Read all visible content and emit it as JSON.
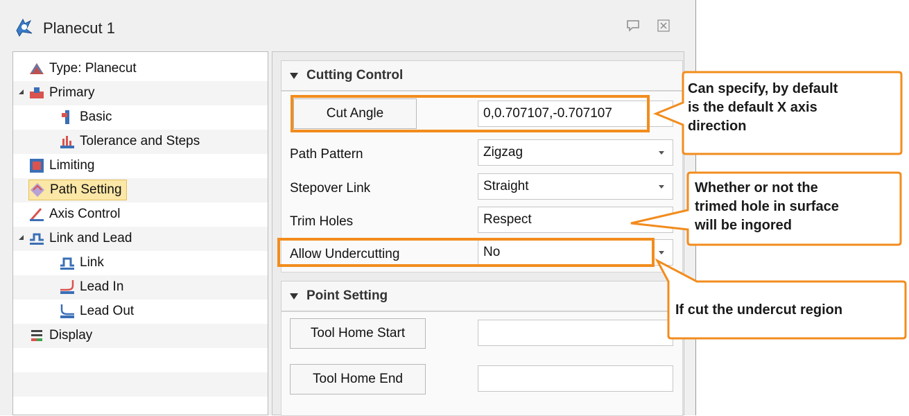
{
  "window": {
    "title": "Planecut 1"
  },
  "tree": {
    "items": [
      {
        "label": "Type: Planecut"
      },
      {
        "label": "Primary"
      },
      {
        "label": "Basic"
      },
      {
        "label": "Tolerance and Steps"
      },
      {
        "label": "Limiting"
      },
      {
        "label": "Path Setting",
        "selected": true
      },
      {
        "label": "Axis Control"
      },
      {
        "label": "Link and Lead"
      },
      {
        "label": "Link"
      },
      {
        "label": "Lead In"
      },
      {
        "label": "Lead Out"
      },
      {
        "label": "Display"
      }
    ]
  },
  "cutting_control": {
    "title": "Cutting Control",
    "cut_angle_label": "Cut Angle",
    "cut_angle_value": "0,0.707107,-0.707107",
    "path_pattern_label": "Path Pattern",
    "path_pattern_value": "Zigzag",
    "stepover_link_label": "Stepover Link",
    "stepover_link_value": "Straight",
    "trim_holes_label": "Trim Holes",
    "trim_holes_value": "Respect",
    "allow_undercutting_label": "Allow Undercutting",
    "allow_undercutting_value": "No"
  },
  "point_setting": {
    "title": "Point Setting",
    "tool_home_start_label": "Tool Home Start",
    "tool_home_start_value": "",
    "tool_home_end_label": "Tool Home End",
    "tool_home_end_value": ""
  },
  "callouts": {
    "cut_angle_line1": "Can specify, by default",
    "cut_angle_line2": "is the default X axis",
    "cut_angle_line3": "direction",
    "trim_holes_line1": "Whether or not the",
    "trim_holes_line2": "trimed hole in surface",
    "trim_holes_line3": "will be ingored",
    "undercut_line1": "If cut the undercut region"
  },
  "colors": {
    "highlight": "#f28c1e",
    "selection": "#fbe7a6"
  }
}
